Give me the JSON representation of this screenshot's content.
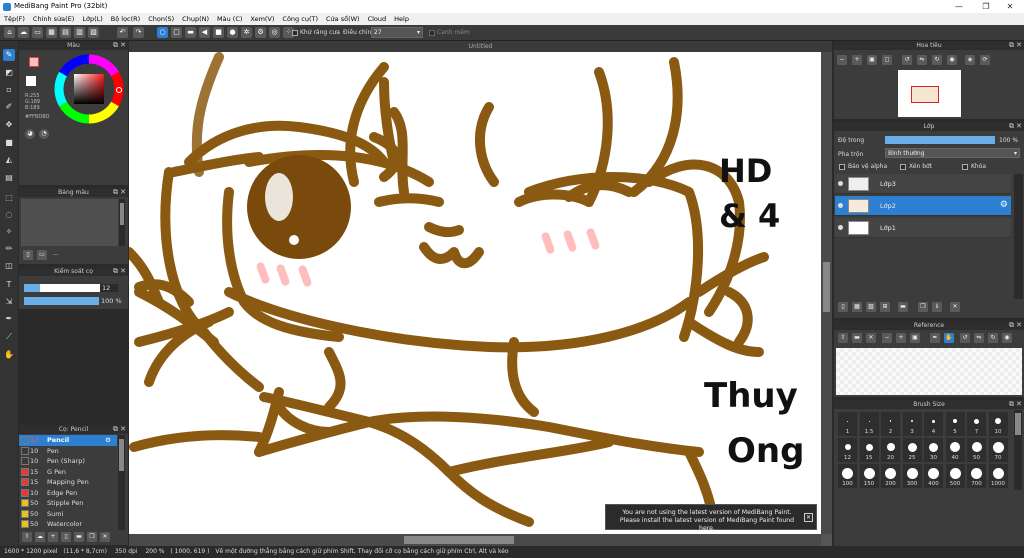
{
  "window": {
    "title": "MediBang Paint Pro (32bit)",
    "minimize": "—",
    "maximize": "❐",
    "close": "✕"
  },
  "menu": [
    "Tệp(F)",
    "Chỉnh sửa(E)",
    "Lớp(L)",
    "Bộ lọc(R)",
    "Chọn(S)",
    "Chụp(N)",
    "Màu (C)",
    "Xem(V)",
    "Công cụ(T)",
    "Cửa sổ(W)",
    "Cloud",
    "Help"
  ],
  "toolbar": {
    "antialias_label": "Khử răng cưa",
    "adjust_label": "Điều chỉnh",
    "adjust_value": "27",
    "edge_label": "Cạnh mềm"
  },
  "color_panel": {
    "title": "Màu",
    "r": "R:255",
    "g": "G:189",
    "b": "B:189",
    "hex": "#FFBDBD",
    "primary_color": "#FFBDBD",
    "secondary_color": "#FFFFFF"
  },
  "palette_panel": {
    "title": "Bảng màu",
    "more": "..."
  },
  "brush_control": {
    "title": "Kiểm soát cọ",
    "size": "12",
    "opacity": "100 %"
  },
  "brush_panel": {
    "title": "Cọ: Pencil",
    "items": [
      {
        "size": "12",
        "name": "Pencil",
        "color": "#2d7fd1",
        "selected": true
      },
      {
        "size": "10",
        "name": "Pen",
        "color": "#3a3a3a"
      },
      {
        "size": "10",
        "name": "Pen (Sharp)",
        "color": "#3a3a3a"
      },
      {
        "size": "15",
        "name": "G Pen",
        "color": "#e03b3b"
      },
      {
        "size": "15",
        "name": "Mapping Pen",
        "color": "#e03b3b"
      },
      {
        "size": "10",
        "name": "Edge Pen",
        "color": "#e03b3b"
      },
      {
        "size": "50",
        "name": "Stipple Pen",
        "color": "#e6c21a"
      },
      {
        "size": "50",
        "name": "Sumi",
        "color": "#e6c21a"
      },
      {
        "size": "50",
        "name": "Watercolor",
        "color": "#e6c21a"
      }
    ]
  },
  "canvas": {
    "doc_title": "Untitled",
    "art_text_1": "HD",
    "art_text_2": "& 4",
    "art_text_3": "Thuy",
    "art_text_4": "Ong"
  },
  "notice": {
    "line1": "You are not using the latest version of MediBang Paint.",
    "line2": "Please install the latest version of MediBang Paint found here.",
    "close": "✕"
  },
  "navigator": {
    "title": "Hoa tiêu"
  },
  "layer_panel": {
    "title": "Lớp",
    "opacity_label": "Độ trong",
    "opacity_value": "100 %",
    "blend_label": "Pha trộn",
    "blend_value": "Bình thường",
    "protect_alpha": "Bảo vệ alpha",
    "clipping": "Xén bớt",
    "lock": "Khóa",
    "layers": [
      {
        "name": "Lớp3",
        "selected": false
      },
      {
        "name": "Lớp2",
        "selected": true
      },
      {
        "name": "Lớp1",
        "selected": false
      }
    ]
  },
  "reference": {
    "title": "Reference"
  },
  "brush_size": {
    "title": "Brush Size",
    "sizes": [
      "1",
      "1.5",
      "2",
      "3",
      "4",
      "5",
      "7",
      "10",
      "12",
      "15",
      "20",
      "25",
      "30",
      "40",
      "50",
      "70",
      "100",
      "150",
      "200",
      "300",
      "400",
      "500",
      "700",
      "1000"
    ]
  },
  "status": {
    "dims": "1600 * 1200 pixel",
    "phys": "(11,6 * 8,7cm)",
    "dpi": "350 dpi",
    "zoom": "200 %",
    "coords": "( 1000, 619 )",
    "hint": "Vẽ một đường thẳng bằng cách giữ phím Shift, Thay đổi cỡ cọ bằng cách giữ phím Ctrl, Alt và kéo"
  }
}
